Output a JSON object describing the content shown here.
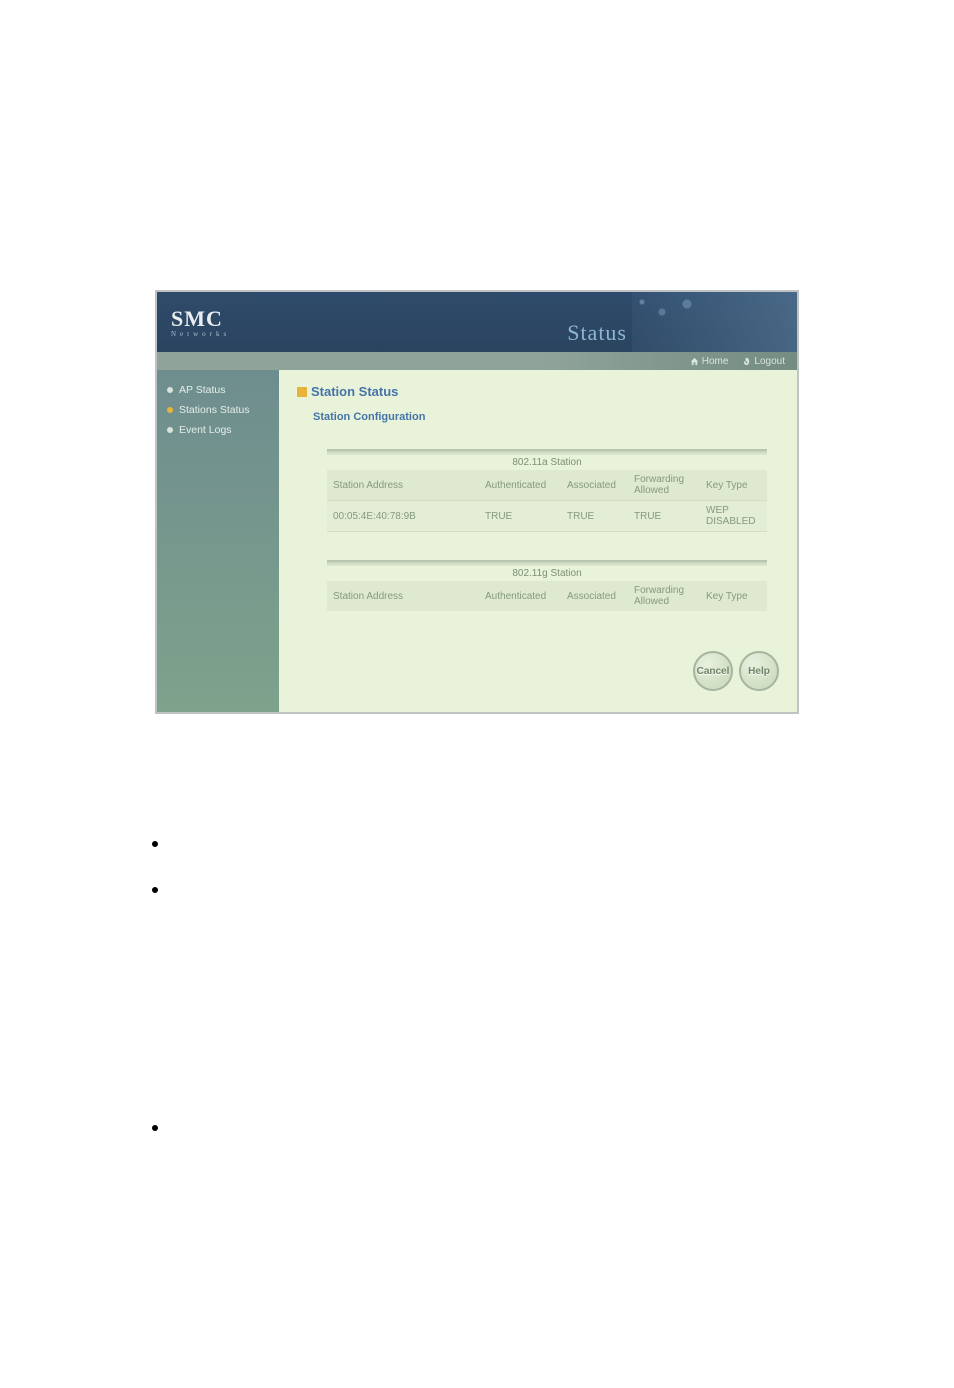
{
  "logo": {
    "main": "SMC",
    "sub": "Networks"
  },
  "header": {
    "status": "Status"
  },
  "topbar": {
    "home_label": "Home",
    "logout_label": "Logout"
  },
  "sidebar": {
    "items": [
      {
        "label": "AP Status",
        "active": false
      },
      {
        "label": "Stations Status",
        "active": true
      },
      {
        "label": "Event Logs",
        "active": false
      }
    ]
  },
  "main": {
    "title": "Station Status",
    "subheading": "Station Configuration",
    "tables": [
      {
        "caption": "802.11a Station",
        "columns": [
          "Station Address",
          "Authenticated",
          "Associated",
          "Forwarding Allowed",
          "Key Type"
        ],
        "rows": [
          [
            "00:05:4E:40:78:9B",
            "TRUE",
            "TRUE",
            "TRUE",
            "WEP DISABLED"
          ]
        ]
      },
      {
        "caption": "802.11g Station",
        "columns": [
          "Station Address",
          "Authenticated",
          "Associated",
          "Forwarding Allowed",
          "Key Type"
        ],
        "rows": []
      }
    ],
    "buttons": {
      "cancel": "Cancel",
      "help": "Help"
    }
  }
}
